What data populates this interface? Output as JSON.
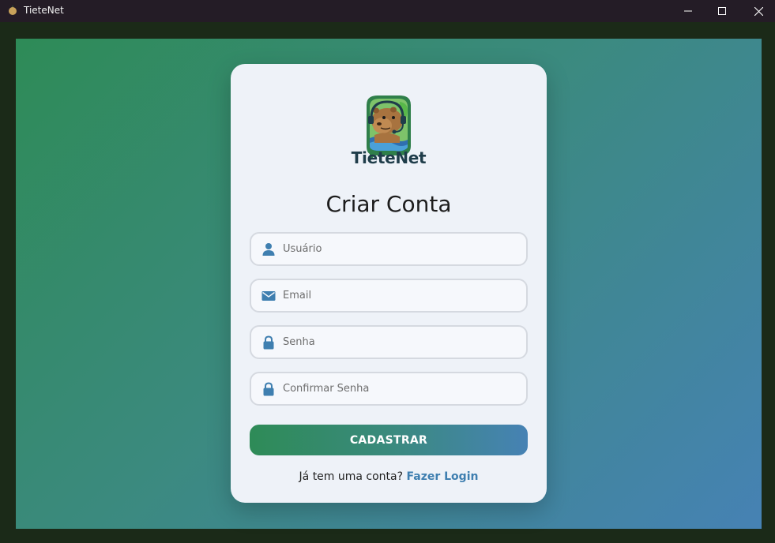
{
  "window": {
    "title": "TieteNet"
  },
  "brand": {
    "name": "TieteNet",
    "logo_icon": "capybara-headset-logo"
  },
  "form": {
    "heading": "Criar Conta",
    "fields": [
      {
        "icon": "user-icon",
        "placeholder": "Usuário",
        "value": ""
      },
      {
        "icon": "envelope-icon",
        "placeholder": "Email",
        "value": ""
      },
      {
        "icon": "lock-icon",
        "placeholder": "Senha",
        "value": ""
      },
      {
        "icon": "lock-icon",
        "placeholder": "Confirmar Senha",
        "value": ""
      }
    ],
    "submit_label": "CADASTRAR",
    "footer_prompt": "Já tem uma conta?",
    "footer_link": "Fazer Login"
  },
  "colors": {
    "accent_green": "#2e8b57",
    "accent_blue": "#4682b4",
    "icon_blue": "#3f7fb0",
    "card_bg": "#eef2f8"
  }
}
